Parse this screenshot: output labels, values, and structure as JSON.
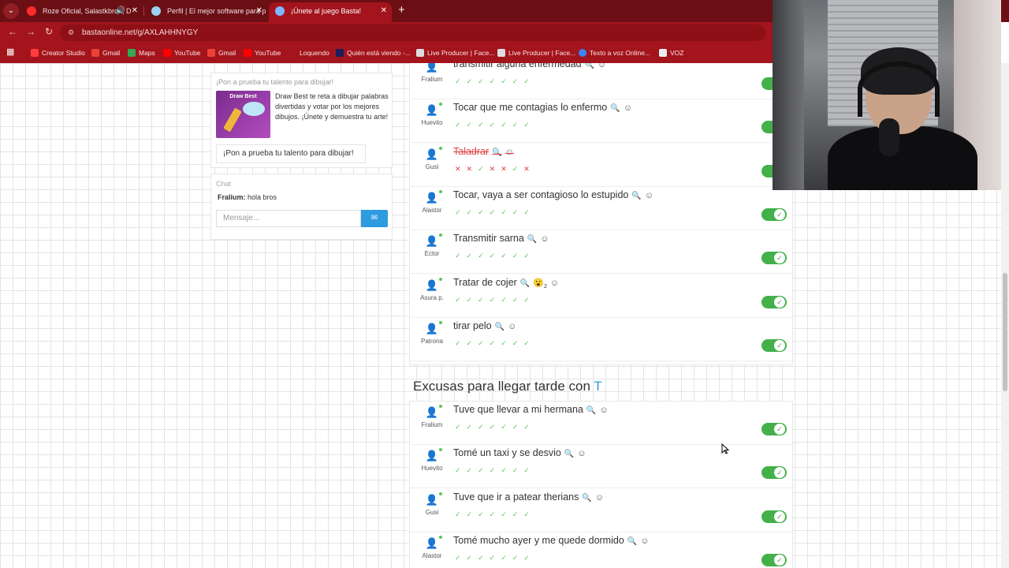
{
  "browser": {
    "tabs": [
      {
        "title": "Roze Oficial, Salastkbron, D",
        "active": false
      },
      {
        "title": "Perfil | El mejor software para p",
        "active": false
      },
      {
        "title": "¡Únete al juego Basta!",
        "active": true
      }
    ],
    "new_tab": "+",
    "url": "bastaonline.net/g/AXLAHHNYGY",
    "bookmarks": [
      "Creator Studio",
      "Gmail",
      "Maps",
      "YouTube",
      "Gmail",
      "YouTube",
      "Loquendo",
      "Quién está viendo -...",
      "Live Producer | Face...",
      "Live Producer | Face...",
      "Texto a voz Online...",
      "VOZ"
    ]
  },
  "promo": {
    "heading": "¡Pon a prueba tu talento para dibujar!",
    "image_text": "Draw Best",
    "description": "Draw Best te reta a dibujar palabras divertidas y votar por los mejores dibujos. ¡Únete y demuestra tu arte!",
    "button": "¡Pon a prueba tu talento para dibujar!"
  },
  "chat": {
    "title": "Chat",
    "messages": [
      {
        "user": "Fralium:",
        "text": "hola bros"
      }
    ],
    "placeholder": "Mensaje..."
  },
  "section1": {
    "rows": [
      {
        "answer": "transmitir alguna enfermedad",
        "player": "Fralium",
        "votes": [
          "ok",
          "ok",
          "ok",
          "ok",
          "ok",
          "ok",
          "ok"
        ],
        "struck": false,
        "toggle": true
      },
      {
        "answer": "Tocar que me contagias lo enfermo",
        "player": "Huevito",
        "votes": [
          "ok",
          "ok",
          "ok",
          "ok",
          "ok",
          "ok",
          "ok"
        ],
        "struck": false,
        "toggle": true
      },
      {
        "answer": "Taladrar",
        "player": "Gusi",
        "votes": [
          "no",
          "no",
          "ok",
          "no",
          "no",
          "ok",
          "no"
        ],
        "struck": true,
        "toggle": true
      },
      {
        "answer": "Tocar, vaya a ser contagioso lo estupido",
        "player": "Alastor",
        "votes": [
          "ok",
          "ok",
          "ok",
          "ok",
          "ok",
          "ok",
          "ok"
        ],
        "struck": false,
        "toggle": true
      },
      {
        "answer": "Transmitir sarna",
        "player": "Ector",
        "votes": [
          "ok",
          "ok",
          "ok",
          "ok",
          "ok",
          "ok",
          "ok"
        ],
        "struck": false,
        "toggle": true
      },
      {
        "answer": "Tratar de cojer",
        "player": "Asura p.",
        "votes": [
          "ok",
          "ok",
          "ok",
          "ok",
          "ok",
          "ok",
          "ok"
        ],
        "struck": false,
        "toggle": true,
        "reaction": "😮",
        "reaction_count": "2"
      },
      {
        "answer": "tirar pelo",
        "player": "Patrona",
        "votes": [
          "ok",
          "ok",
          "ok",
          "ok",
          "ok",
          "ok",
          "ok"
        ],
        "struck": false,
        "toggle": true
      }
    ]
  },
  "section2": {
    "category_prefix": "Excusas para llegar tarde con",
    "category_letter": "T",
    "rows": [
      {
        "answer": "Tuve que llevar a mi hermana",
        "player": "Fralium",
        "votes": [
          "ok",
          "ok",
          "ok",
          "ok",
          "ok",
          "ok",
          "ok"
        ],
        "toggle": true
      },
      {
        "answer": "Tomé un taxi y se desvio",
        "player": "Huevito",
        "votes": [
          "ok",
          "ok",
          "ok",
          "ok",
          "ok",
          "ok",
          "ok"
        ],
        "toggle": true
      },
      {
        "answer": "Tuve que ir a patear therians",
        "player": "Gusi",
        "votes": [
          "ok",
          "ok",
          "ok",
          "ok",
          "ok",
          "ok",
          "ok"
        ],
        "toggle": true
      },
      {
        "answer": "Tomé mucho ayer y me quede dormido",
        "player": "Alastor",
        "votes": [
          "ok",
          "ok",
          "ok",
          "ok",
          "ok",
          "ok",
          "ok"
        ],
        "toggle": true
      }
    ]
  },
  "icons": {
    "search": "🔍",
    "emoji": "☺",
    "avatar": "👤",
    "ok": "✓",
    "no": "✕"
  }
}
